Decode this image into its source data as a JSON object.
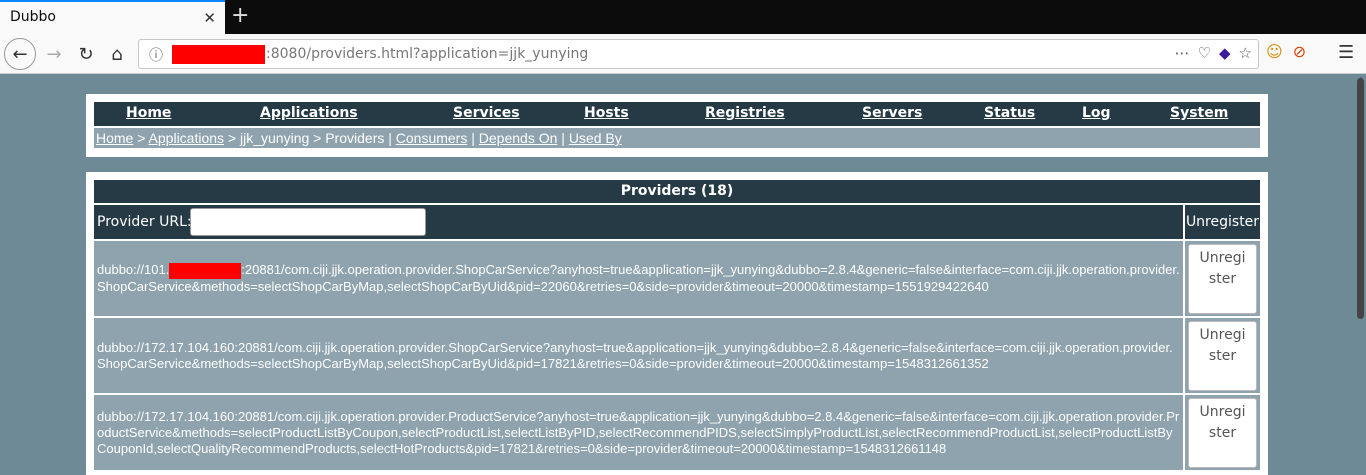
{
  "browser": {
    "tab_title": "Dubbo",
    "close_glyph": "✕",
    "new_tab_glyph": "+",
    "url_suffix": ":8080/providers.html?application=jjk_yunying"
  },
  "menu": [
    {
      "label": "Home"
    },
    {
      "label": "Applications"
    },
    {
      "label": "Services"
    },
    {
      "label": "Hosts"
    },
    {
      "label": "Registries"
    },
    {
      "label": "Servers"
    },
    {
      "label": "Status"
    },
    {
      "label": "Log"
    },
    {
      "label": "System"
    }
  ],
  "breadcrumb": {
    "home": "Home",
    "sep1": " > ",
    "applications": "Applications",
    "sep2": " > jjk_yunying > Providers | ",
    "consumers": "Consumers",
    "sep3": " | ",
    "depends_on": "Depends On",
    "sep4": " | ",
    "used_by": "Used By"
  },
  "table": {
    "title": "Providers (18)",
    "filter_label": "Provider URL:",
    "unregister_header": "Unregister",
    "button_label": "Unregister",
    "rows": [
      {
        "prefix": "dubbo://101.",
        "url": ":20881/com.ciji.jjk.operation.provider.ShopCarService?anyhost=true&application=jjk_yunying&dubbo=2.8.4&generic=false&interface=com.ciji.jjk.operation.provider.ShopCarService&methods=selectShopCarByMap,selectShopCarByUid&pid=22060&retries=0&side=provider&timeout=20000&timestamp=1551929422640"
      },
      {
        "url": "dubbo://172.17.104.160:20881/com.ciji.jjk.operation.provider.ShopCarService?anyhost=true&application=jjk_yunying&dubbo=2.8.4&generic=false&interface=com.ciji.jjk.operation.provider.ShopCarService&methods=selectShopCarByMap,selectShopCarByUid&pid=17821&retries=0&side=provider&timeout=20000&timestamp=1548312661352"
      },
      {
        "url": "dubbo://172.17.104.160:20881/com.ciji.jjk.operation.provider.ProductService?anyhost=true&application=jjk_yunying&dubbo=2.8.4&generic=false&interface=com.ciji.jjk.operation.provider.ProductService&methods=selectProductListByCoupon,selectProductList,selectListByPID,selectRecommendPIDS,selectSimplyProductList,selectRecommendProductList,selectProductListByCouponId,selectQualityRecommendProducts,selectHotProducts&pid=17821&retries=0&side=provider&timeout=20000&timestamp=1548312661148"
      }
    ]
  }
}
